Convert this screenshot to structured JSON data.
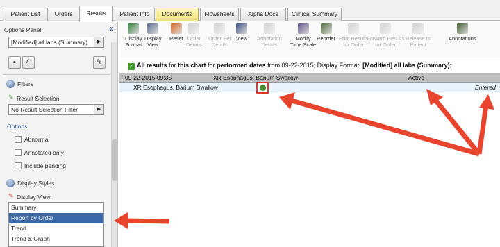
{
  "tabs": [
    {
      "label": "Patient List",
      "active": false,
      "highlight": false
    },
    {
      "label": "Orders",
      "active": false,
      "highlight": false
    },
    {
      "label": "Results",
      "active": true,
      "highlight": false
    },
    {
      "label": "Patient Info",
      "active": false,
      "highlight": false
    },
    {
      "label": "Documents",
      "active": false,
      "highlight": true
    },
    {
      "label": "Flowsheets",
      "active": false,
      "highlight": false
    },
    {
      "label": "Alpha Docs",
      "active": false,
      "highlight": false
    },
    {
      "label": "Clinical Summary",
      "active": false,
      "highlight": false
    }
  ],
  "options_panel": {
    "title": "Options Panel",
    "view_select": "[Modified] all labs (Summary)",
    "filters_title": "Filters",
    "result_selection_label": "Result Selection:",
    "result_filter_select": "No Result Selection Filter",
    "options_label": "Options",
    "checkboxes": [
      "Abnormal",
      "Annotated only",
      "Include pending"
    ],
    "display_styles_title": "Display Styles",
    "display_view_label": "Display View:",
    "display_views": [
      "Summary",
      "Report by Order",
      "Trend",
      "Trend & Graph"
    ],
    "selected_view": "Report by Order"
  },
  "toolbar": [
    {
      "line1": "Display",
      "line2": "Format",
      "icon": "display-format-icon",
      "enabled": true,
      "color": "#2f7d3a"
    },
    {
      "line1": "Display",
      "line2": "View",
      "icon": "display-view-icon",
      "enabled": true,
      "color": "#5a6d8f"
    },
    {
      "line1": "Reset",
      "line2": "",
      "icon": "reset-icon",
      "enabled": true,
      "color": "#d9661e"
    },
    {
      "line1": "Order",
      "line2": "Details",
      "icon": "order-details-icon",
      "enabled": false,
      "color": "#888888"
    },
    {
      "line1": "Order Set",
      "line2": "Details",
      "icon": "order-set-details-icon",
      "enabled": false,
      "color": "#888888"
    },
    {
      "line1": "View",
      "line2": "",
      "icon": "view-icon",
      "enabled": true,
      "color": "#3c4f80"
    },
    {
      "line1": "Annotation",
      "line2": "Details",
      "icon": "annotation-details-icon",
      "enabled": false,
      "color": "#888888"
    },
    {
      "line1": "Modify",
      "line2": "Time Scale",
      "icon": "modify-time-scale-icon",
      "enabled": true,
      "color": "#5b4d86"
    },
    {
      "line1": "Reorder",
      "line2": "",
      "icon": "reorder-icon",
      "enabled": true,
      "color": "#4e6b3a"
    },
    {
      "line1": "Print Results",
      "line2": "for Order",
      "icon": "print-results-icon",
      "enabled": false,
      "color": "#888888"
    },
    {
      "line1": "Forward Results",
      "line2": "for Order",
      "icon": "forward-results-icon",
      "enabled": false,
      "color": "#888888"
    },
    {
      "line1": "Release to",
      "line2": "Patient",
      "icon": "release-to-patient-icon",
      "enabled": false,
      "color": "#888888"
    },
    {
      "line1": "Annotations",
      "line2": "",
      "icon": "annotations-icon",
      "enabled": true,
      "color": "#3d5a2c"
    }
  ],
  "caption": {
    "prefix": "All results",
    "text1": " for ",
    "bold1": "this chart",
    "text2": " for ",
    "bold2": "performed dates",
    "text3": " from 09-22-2015; Display Format: ",
    "bold3": "[Modified] all labs (Summary);"
  },
  "grid": {
    "header": {
      "date": "09-22-2015 09:35",
      "order": "XR Esophagus, Barium Swallow",
      "status": "Active"
    },
    "row": {
      "test": "XR Esophagus, Barium Swallow",
      "status": "Entered"
    }
  },
  "colors": {
    "arrow": "#e8442e",
    "selection": "#3b68a8",
    "highlight_box": "#e0382a"
  }
}
